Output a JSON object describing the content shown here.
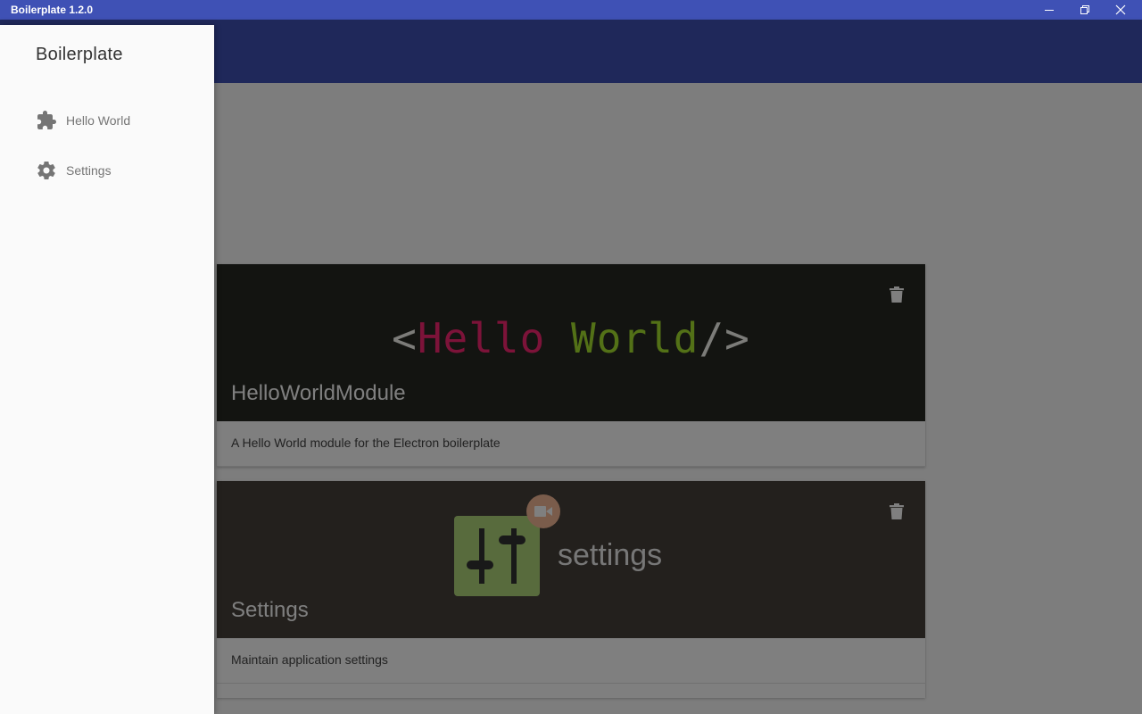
{
  "window": {
    "title": "Boilerplate 1.2.0",
    "buttons": [
      "minimize",
      "restore",
      "close"
    ]
  },
  "drawer": {
    "title": "Boilerplate",
    "items": [
      {
        "label": "Hello World",
        "icon": "puzzle-icon"
      },
      {
        "label": "Settings",
        "icon": "gear-icon"
      }
    ]
  },
  "cards": [
    {
      "title": "HelloWorldModule",
      "description": "A Hello World module for the Electron boilerplate",
      "media": {
        "open": "<",
        "word1": "Hello",
        "word2": "World",
        "close": "/>"
      },
      "action_icon": "trash-icon"
    },
    {
      "title": "Settings",
      "description": "Maintain application settings",
      "media": {
        "word": "settings"
      },
      "action_icon": "trash-icon"
    }
  ],
  "colors": {
    "primary": "#3f51b5",
    "drawer_bg": "#fafafa",
    "overlay": "rgba(0,0,0,0.5)"
  }
}
